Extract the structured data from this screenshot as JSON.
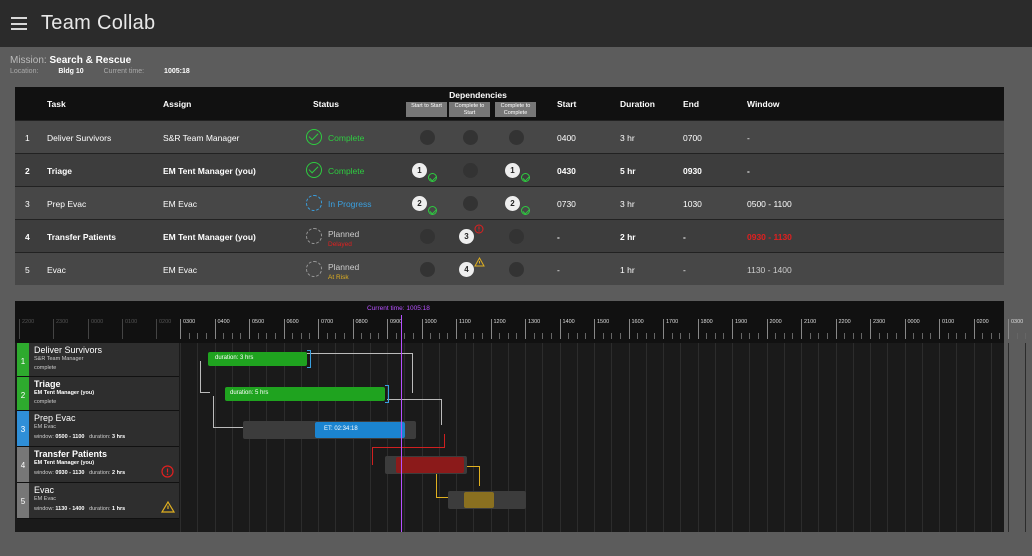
{
  "app": {
    "title": "Team Collab"
  },
  "mission": {
    "label": "Mission:",
    "name": "Search & Rescue",
    "location_label": "Location:",
    "location": "Bldg 10",
    "time_label": "Current time:",
    "time": "1005:18"
  },
  "table": {
    "headers": {
      "task": "Task",
      "assign": "Assign",
      "status": "Status",
      "dependencies": "Dependencies",
      "dep1": "Start to Start",
      "dep2": "Complete to Start",
      "dep3": "Complete to Complete",
      "start": "Start",
      "duration": "Duration",
      "end": "End",
      "window": "Window"
    },
    "rows": [
      {
        "num": "1",
        "task": "Deliver Survivors",
        "assign": "S&R Team Manager",
        "status": "Complete",
        "sub": "",
        "start": "0400",
        "duration": "3 hr",
        "end": "0700",
        "window": "-"
      },
      {
        "num": "2",
        "task": "Triage",
        "assign": "EM Tent Manager (you)",
        "status": "Complete",
        "sub": "",
        "start": "0430",
        "duration": "5 hr",
        "end": "0930",
        "window": "-",
        "dep1": "1",
        "dep3": "1"
      },
      {
        "num": "3",
        "task": "Prep Evac",
        "assign": "EM Evac",
        "status": "In Progress",
        "sub": "",
        "start": "0730",
        "duration": "3 hr",
        "end": "1030",
        "window": "0500 - 1100",
        "dep1": "2",
        "dep3": "2"
      },
      {
        "num": "4",
        "task": "Transfer Patients",
        "assign": "EM Tent Manager (you)",
        "status": "Planned",
        "sub": "Delayed",
        "start": "-",
        "duration": "2 hr",
        "end": "-",
        "window": "0930 - 1130",
        "dep2": "3"
      },
      {
        "num": "5",
        "task": "Evac",
        "assign": "EM Evac",
        "status": "Planned",
        "sub": "At Risk",
        "start": "-",
        "duration": "1 hr",
        "end": "-",
        "window": "1130 - 1400",
        "dep2": "4"
      }
    ]
  },
  "colors": {
    "complete": "#2ecc40",
    "progress": "#3aa0e0",
    "planned": "#999999",
    "delayed": "#e02020",
    "atrisk": "#e0b020",
    "current": "#b650ff"
  },
  "gantt": {
    "current_time_label": "Current time: 1005:18",
    "ticks_dim": [
      "2200",
      "2300",
      "0000",
      "0100",
      "0200"
    ],
    "ticks": [
      "0300",
      "0400",
      "0500",
      "0600",
      "0700",
      "0800",
      "0900",
      "1000",
      "1100",
      "1200",
      "1300",
      "1400",
      "1500",
      "1600",
      "1700",
      "1800",
      "1900",
      "2000",
      "2100",
      "2200",
      "2300",
      "0000",
      "0100",
      "0200",
      "0300",
      "0400"
    ],
    "tasks": [
      {
        "num": "1",
        "name": "Deliver Survivors",
        "assign": "S&R Team Manager",
        "status": "complete"
      },
      {
        "num": "2",
        "name": "Triage",
        "assign": "EM Tent Manager (you)",
        "status": "complete"
      },
      {
        "num": "3",
        "name": "Prep Evac",
        "assign": "EM Evac",
        "window_label": "window:",
        "window": "0500 - 1100",
        "duration_label": "duration:",
        "duration": "3 hrs"
      },
      {
        "num": "4",
        "name": "Transfer Patients",
        "assign": "EM Tent Manager (you)",
        "window_label": "window:",
        "window": "0930 - 1130",
        "duration_label": "duration:",
        "duration": "2 hrs"
      },
      {
        "num": "5",
        "name": "Evac",
        "assign": "EM Evac",
        "window_label": "window:",
        "window": "1130 - 1400",
        "duration_label": "duration:",
        "duration": "1 hrs"
      }
    ],
    "bar1_label": "duration: 3 hrs",
    "bar2_label": "duration: 5 hrs",
    "bar3_label": "ET: 02:34:18"
  }
}
